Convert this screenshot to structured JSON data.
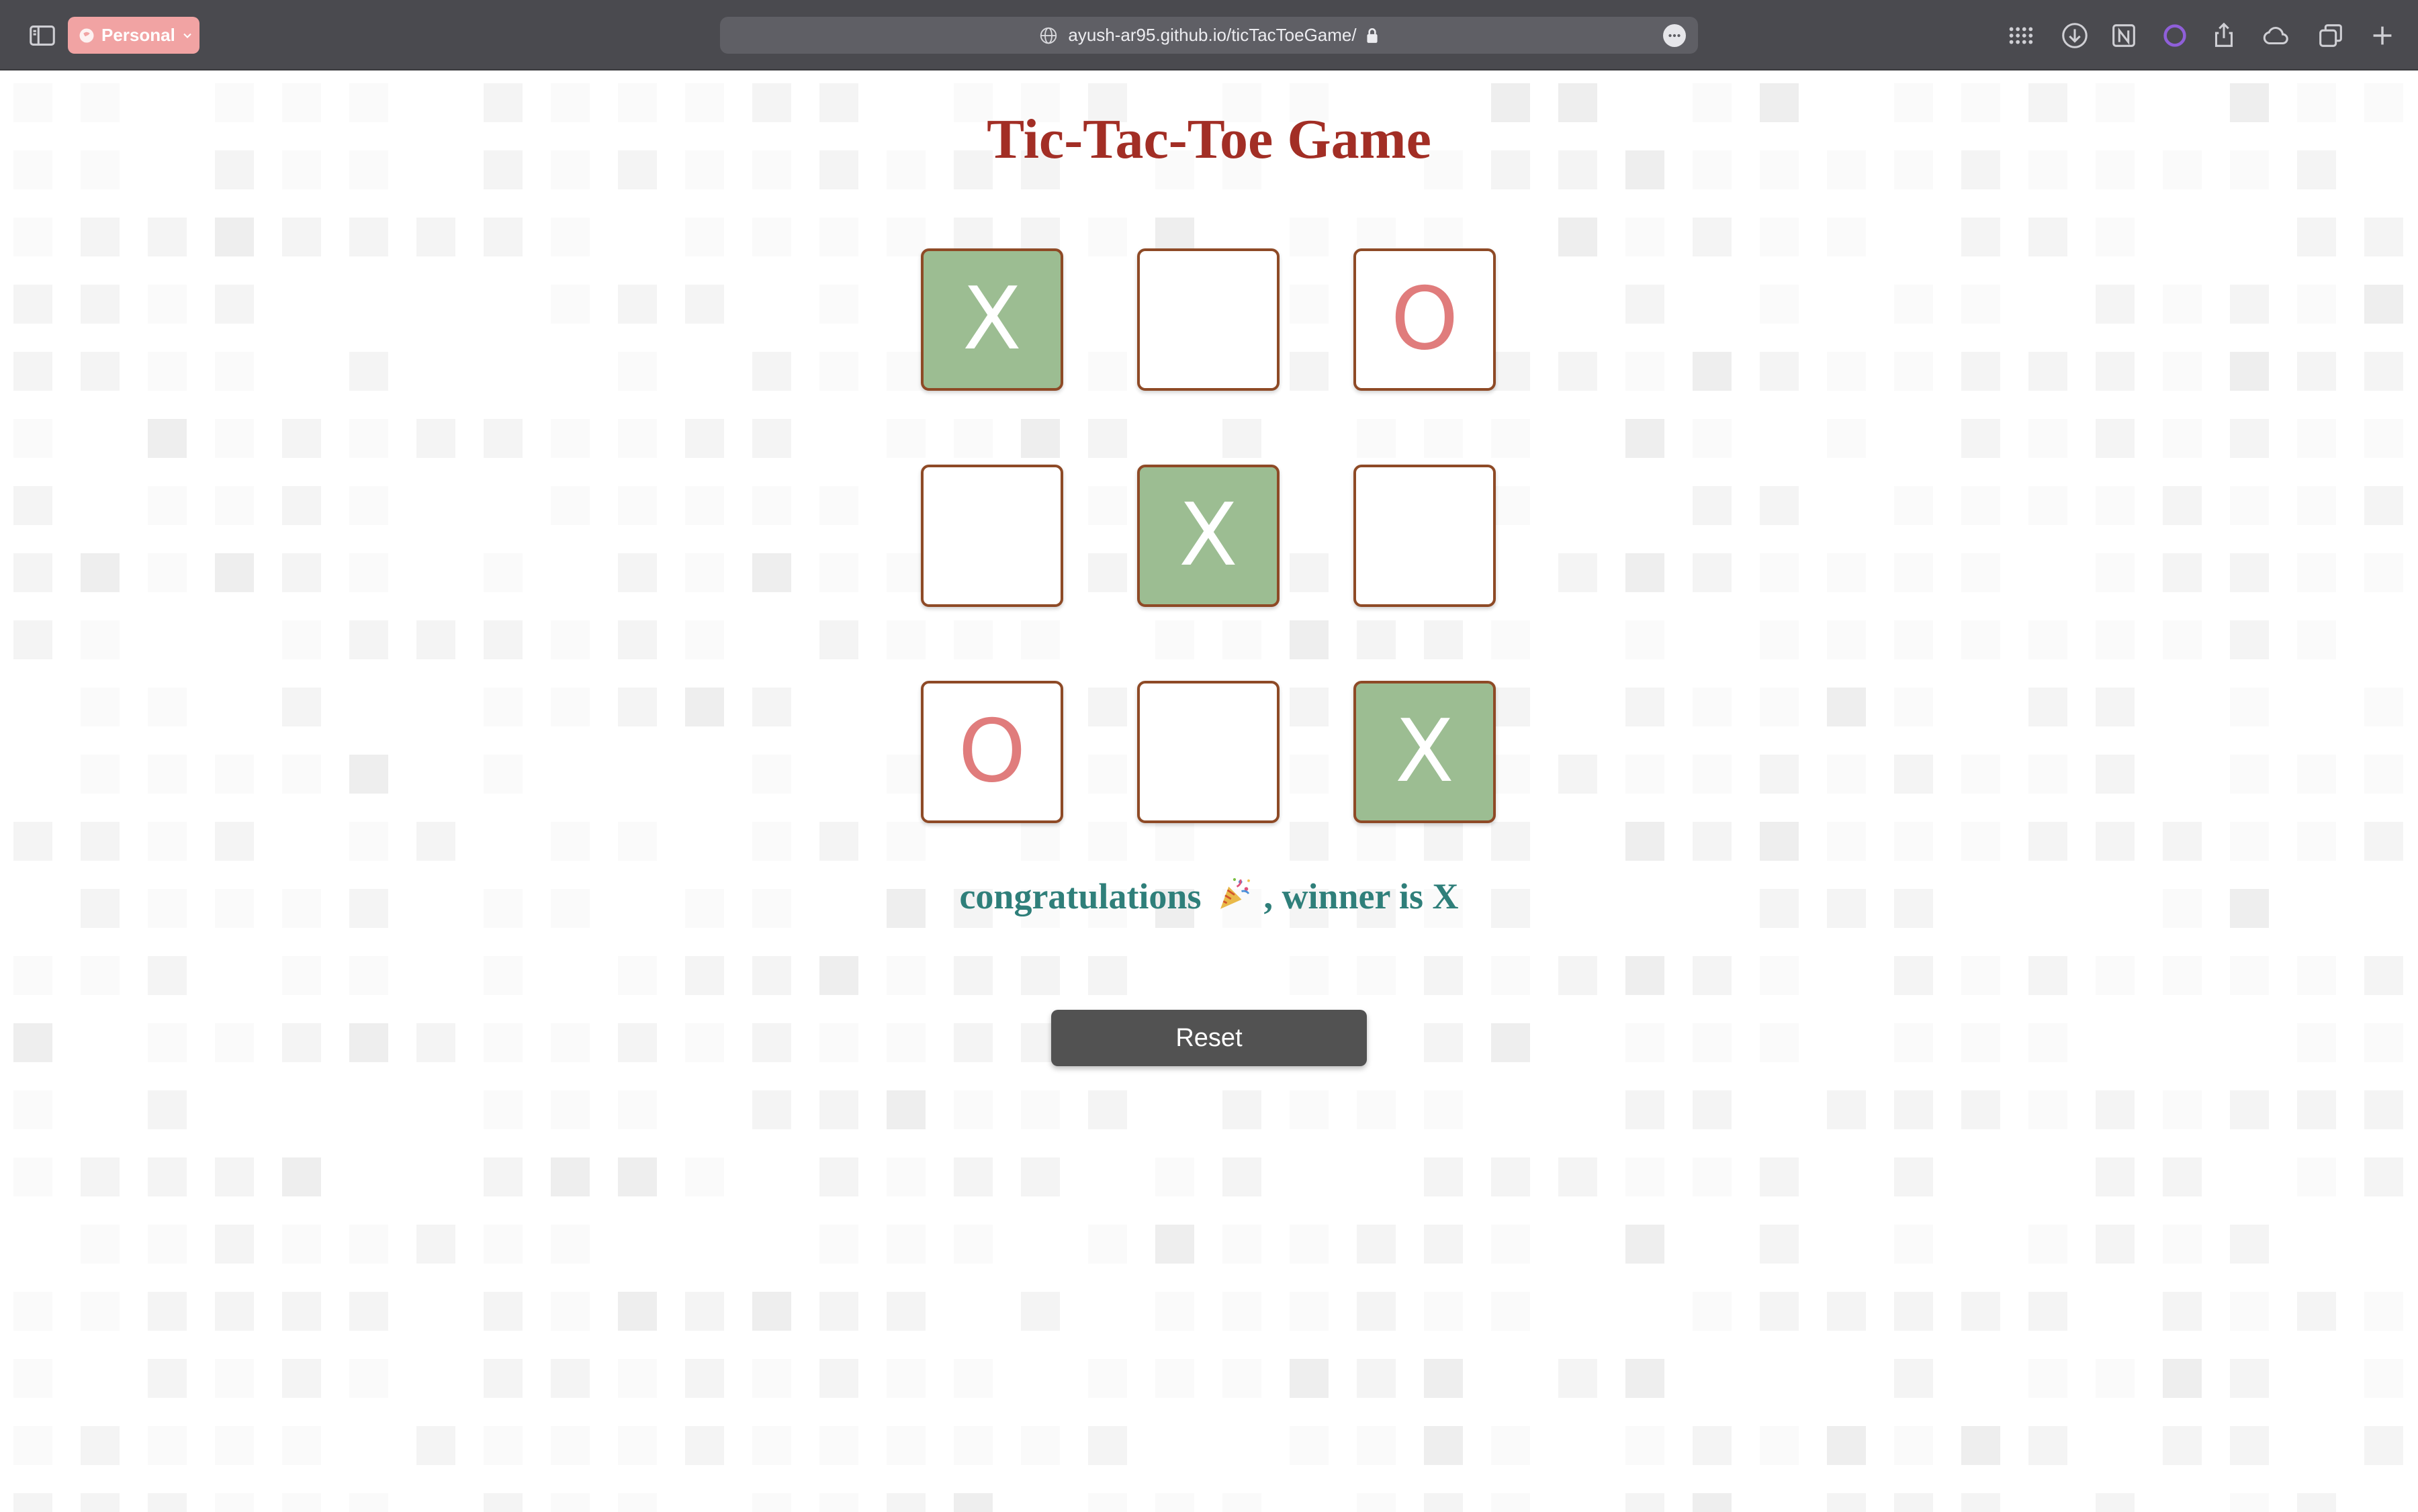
{
  "browser": {
    "profile_label": "Personal",
    "url": "ayush-ar95.github.io/ticTacToeGame/",
    "accent_color": "#f1a3a3"
  },
  "game": {
    "title": "Tic-Tac-Toe Game",
    "board": [
      {
        "mark": "X",
        "winning": true
      },
      {
        "mark": "",
        "winning": false
      },
      {
        "mark": "O",
        "winning": false
      },
      {
        "mark": "",
        "winning": false
      },
      {
        "mark": "X",
        "winning": true
      },
      {
        "mark": "",
        "winning": false
      },
      {
        "mark": "O",
        "winning": false
      },
      {
        "mark": "",
        "winning": false
      },
      {
        "mark": "X",
        "winning": true
      }
    ],
    "status_prefix": "congratulations",
    "status_suffix": ", winner is X",
    "status_icon": "party-popper-icon",
    "reset_label": "Reset",
    "colors": {
      "title": "#a22e25",
      "winning_cell": "#9cbd92",
      "o_mark": "#e07c7c",
      "status": "#2f7f7a",
      "cell_border": "#8e4a26",
      "reset_button": "#525252"
    }
  }
}
